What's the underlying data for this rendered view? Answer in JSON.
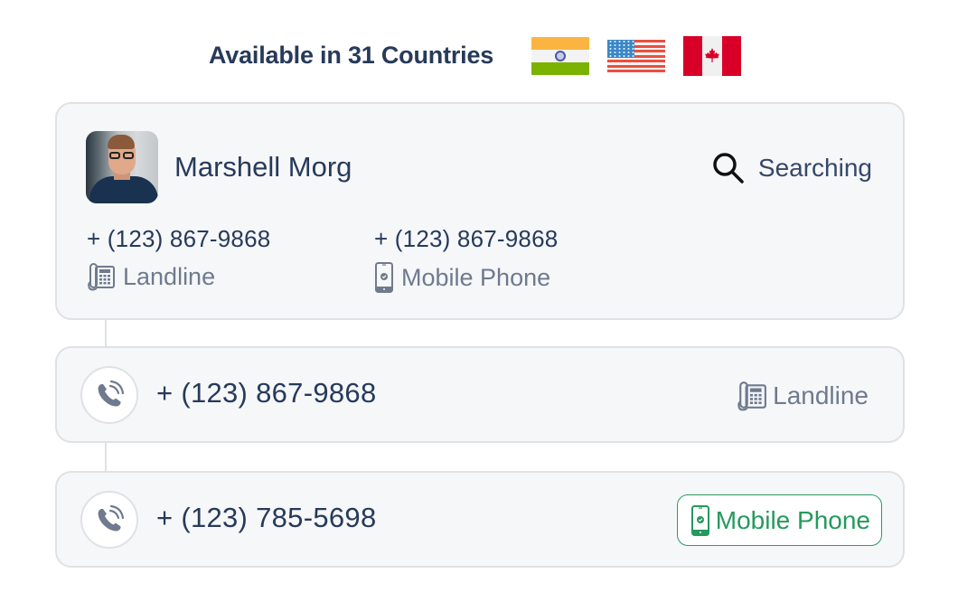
{
  "header": {
    "title": "Available in 31 Countries",
    "flags": [
      {
        "country": "India",
        "icon": "india-flag-icon"
      },
      {
        "country": "United States",
        "icon": "usa-flag-icon"
      },
      {
        "country": "Canada",
        "icon": "canada-flag-icon"
      }
    ]
  },
  "contact": {
    "name": "Marshell Morg",
    "avatar": "profile-photo",
    "status": {
      "label": "Searching",
      "icon": "search-icon"
    },
    "phones": [
      {
        "number": "+ (123) 867-9868",
        "type": "Landline",
        "icon": "landline-phone-icon"
      },
      {
        "number": "+ (123) 867-9868",
        "type": "Mobile Phone",
        "icon": "mobile-phone-icon"
      }
    ]
  },
  "results": [
    {
      "number": "+ (123) 867-9868",
      "type": "Landline",
      "icon": "landline-phone-icon",
      "highlighted": false
    },
    {
      "number": "+ (123) 785-5698",
      "type": "Mobile Phone",
      "icon": "mobile-phone-icon",
      "highlighted": true
    }
  ],
  "colors": {
    "text_primary": "#273a5a",
    "text_muted": "#6f7a8e",
    "card_bg": "#f6f7f9",
    "card_border": "#dfe1e6",
    "accent_green": "#26995e"
  }
}
